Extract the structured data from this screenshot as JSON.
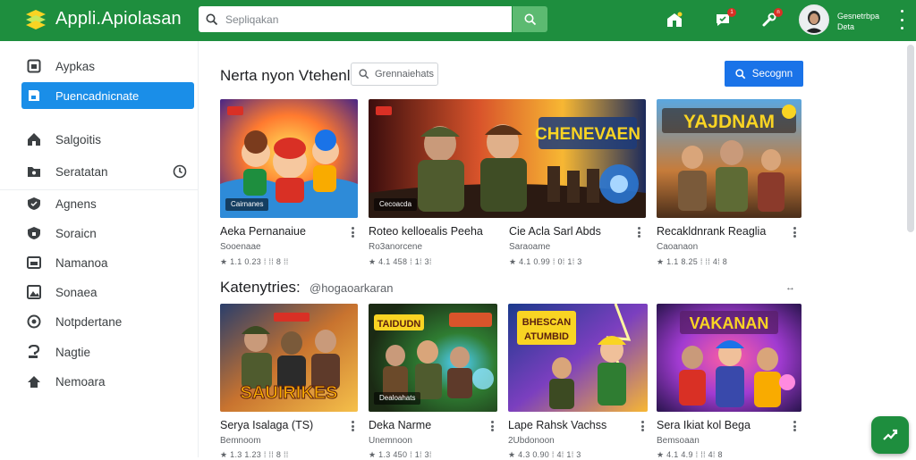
{
  "header": {
    "app_title": "Appli.Apiolasan",
    "search_placeholder": "Sepliqakan",
    "user_name": "Gesnetrbpa",
    "user_sub": "Deta",
    "notification_count": "1",
    "alert_count": "n"
  },
  "sidebar": {
    "items": [
      {
        "label": "Aypkas",
        "icon": "square-icon"
      },
      {
        "label": "Puencadnicnate",
        "icon": "storefront-icon",
        "active": true
      },
      {
        "label": "Salgoitis",
        "icon": "home-icon"
      },
      {
        "label": "Seratatan",
        "icon": "folder-icon"
      },
      {
        "label": "Agnens",
        "icon": "check-shield-icon"
      },
      {
        "label": "Soraicn",
        "icon": "shield-icon"
      },
      {
        "label": "Namanoa",
        "icon": "card-icon"
      },
      {
        "label": "Sonaea",
        "icon": "image-icon"
      },
      {
        "label": "Notpdertane",
        "icon": "eye-icon"
      },
      {
        "label": "Nagtie",
        "icon": "question-icon"
      },
      {
        "label": "Nemoara",
        "icon": "house-icon"
      }
    ]
  },
  "featured": {
    "title": "Nerta nyon Vtehenl",
    "chip_label": "Grennaiehats",
    "button_label": "Secognn",
    "cards": [
      {
        "title": "Aeka Pernanaiue",
        "developer": "Sooenaae",
        "meta": "★ 1.1 0.23 ⁞ ⁞⁞ 8 ⁞⁞",
        "tag": "Cairnanes"
      },
      {
        "title": "Roteo kelloealis Peeha",
        "developer": "Ro3anorcene",
        "meta": "★ 4.1 458 ⁞ 1⁞ 3⁞",
        "tag": "Cecoacda"
      },
      {
        "title": "Cie Acla Sarl Abds",
        "developer": "Saraoame",
        "meta": "★ 4.1 0.99 ⁞ 0⁞ 1⁞ 3",
        "tag": ""
      },
      {
        "title": "Recakldnrank Reaglia",
        "developer": "Caoanaon",
        "meta": "★ 1.1 8.25 ⁞ ⁞⁞ 4⁞ 8",
        "tag": ""
      }
    ]
  },
  "categories": {
    "title": "Katenytries:",
    "subtitle": "@hogaoarkaran",
    "more_label": "↔",
    "cards": [
      {
        "title": "Serya Isalaga (TS)",
        "developer": "Bemnoom",
        "meta": "★ 1.3 1.23 ⁞ ⁞⁞ 8 ⁞⁞",
        "tag": ""
      },
      {
        "title": "Deka Narme",
        "developer": "Unemnoon",
        "meta": "★ 1.3 450 ⁞ 1⁞ 3⁞",
        "tag": "Dealoahats"
      },
      {
        "title": "Lape Rahsk Vachss",
        "developer": "2Ubdonoon",
        "meta": "★ 4.3 0.90 ⁞ 4⁞ 1⁞ 3",
        "tag": ""
      },
      {
        "title": "Sera Ikiat kol Bega",
        "developer": "Bemsoaan",
        "meta": "★ 4.1 4.9 ⁞ ⁞⁞ 4⁞ 8",
        "tag": ""
      }
    ]
  },
  "colors": {
    "brand_green": "#1e8e3e",
    "primary_blue": "#1a73e8",
    "active_blue": "#1a8ee8"
  }
}
